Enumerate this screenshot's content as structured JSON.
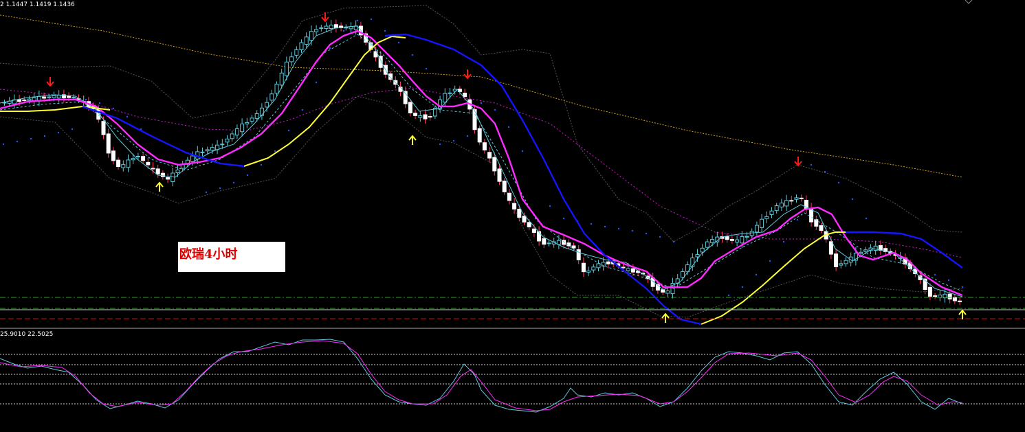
{
  "main_readout": "2 1.1447 1.1419 1.1436",
  "osc_readout": "25.9010 22.5025",
  "chart_label": "欧瑞4小时",
  "chart_data": [
    {
      "type": "candlestick",
      "indicators": [
        "moving averages",
        "envelopes",
        "parabolic dots",
        "signal arrows",
        "horizontal levels"
      ],
      "grid": false,
      "colors": {
        "background": "#000000",
        "bull_candle": "#5ec8d8",
        "bear_candle": "#ffffff",
        "ma_fast": "#ff2aff",
        "ma_slow": "#1414ff",
        "ma_yellow": "#ffff33",
        "ma_long": "#d4a017",
        "sell_arrow": "#ff1a1a",
        "buy_arrow": "#ffff33"
      }
    },
    {
      "type": "line",
      "name": "oscillator",
      "colors": {
        "line_1": "#5ec8d8",
        "line_2": "#ff2aff",
        "levels": "#cccccc"
      }
    }
  ]
}
